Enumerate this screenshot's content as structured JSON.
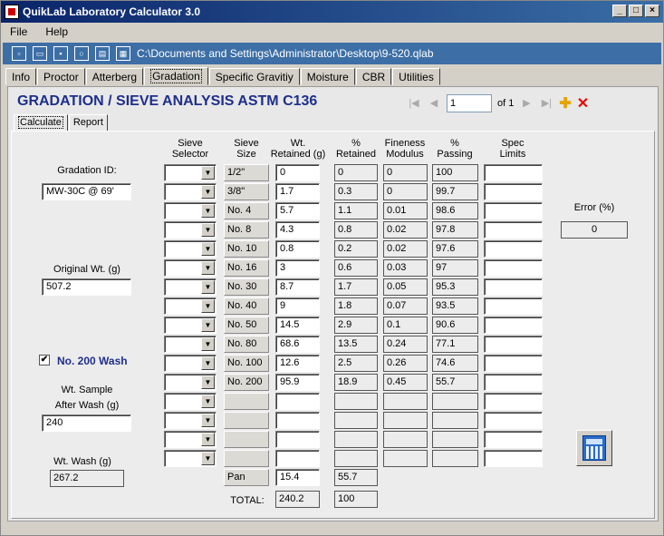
{
  "window": {
    "title": "QuikLab Laboratory Calculator 3.0"
  },
  "menu": {
    "file": "File",
    "help": "Help"
  },
  "toolbar": {
    "path": "C:\\Documents and Settings\\Administrator\\Desktop\\9-520.qlab"
  },
  "tabs": [
    "Info",
    "Proctor",
    "Atterberg",
    "Gradation",
    "Specific Gravitiy",
    "Moisture",
    "CBR",
    "Utilities"
  ],
  "active_tab": "Gradation",
  "section_title": "GRADATION / SIEVE ANALYSIS ASTM C136",
  "navigator": {
    "current": "1",
    "of_label": "of 1"
  },
  "subtabs": [
    "Calculate",
    "Report"
  ],
  "left": {
    "gradation_id_label": "Gradation ID:",
    "gradation_id": "MW-30C @ 69'",
    "original_wt_label": "Original Wt. (g)",
    "original_wt": "507.2",
    "wash_label": "No. 200 Wash",
    "wash_checked": "✔",
    "after_wash_label_1": "Wt. Sample",
    "after_wash_label_2": "After Wash (g)",
    "after_wash": "240",
    "wt_wash_label": "Wt. Wash (g)",
    "wt_wash": "267.2"
  },
  "headers": {
    "selector_1": "Sieve",
    "selector_2": "Selector",
    "size_1": "Sieve",
    "size_2": "Size",
    "wt_1": "Wt.",
    "wt_2": "Retained (g)",
    "ret_1": "%",
    "ret_2": "Retained",
    "fm_1": "Fineness",
    "fm_2": "Modulus",
    "pass_1": "%",
    "pass_2": "Passing",
    "spec_1": "Spec",
    "spec_2": "Limits"
  },
  "rows": [
    {
      "size": "1/2\"",
      "wt": "0",
      "ret": "0",
      "fm": "0",
      "pass": "100"
    },
    {
      "size": "3/8\"",
      "wt": "1.7",
      "ret": "0.3",
      "fm": "0",
      "pass": "99.7"
    },
    {
      "size": "No. 4",
      "wt": "5.7",
      "ret": "1.1",
      "fm": "0.01",
      "pass": "98.6"
    },
    {
      "size": "No. 8",
      "wt": "4.3",
      "ret": "0.8",
      "fm": "0.02",
      "pass": "97.8"
    },
    {
      "size": "No. 10",
      "wt": "0.8",
      "ret": "0.2",
      "fm": "0.02",
      "pass": "97.6"
    },
    {
      "size": "No. 16",
      "wt": "3",
      "ret": "0.6",
      "fm": "0.03",
      "pass": "97"
    },
    {
      "size": "No. 30",
      "wt": "8.7",
      "ret": "1.7",
      "fm": "0.05",
      "pass": "95.3"
    },
    {
      "size": "No. 40",
      "wt": "9",
      "ret": "1.8",
      "fm": "0.07",
      "pass": "93.5"
    },
    {
      "size": "No. 50",
      "wt": "14.5",
      "ret": "2.9",
      "fm": "0.1",
      "pass": "90.6"
    },
    {
      "size": "No. 80",
      "wt": "68.6",
      "ret": "13.5",
      "fm": "0.24",
      "pass": "77.1"
    },
    {
      "size": "No. 100",
      "wt": "12.6",
      "ret": "2.5",
      "fm": "0.26",
      "pass": "74.6"
    },
    {
      "size": "No. 200",
      "wt": "95.9",
      "ret": "18.9",
      "fm": "0.45",
      "pass": "55.7"
    },
    {
      "size": "",
      "wt": "",
      "ret": "",
      "fm": "",
      "pass": ""
    },
    {
      "size": "",
      "wt": "",
      "ret": "",
      "fm": "",
      "pass": ""
    },
    {
      "size": "",
      "wt": "",
      "ret": "",
      "fm": "",
      "pass": ""
    },
    {
      "size": "",
      "wt": "",
      "ret": "",
      "fm": "",
      "pass": ""
    }
  ],
  "pan": {
    "label": "Pan",
    "wt": "15.4",
    "ret": "55.7"
  },
  "total": {
    "label": "TOTAL:",
    "wt": "240.2",
    "ret": "100"
  },
  "error": {
    "label": "Error (%)",
    "value": "0"
  }
}
